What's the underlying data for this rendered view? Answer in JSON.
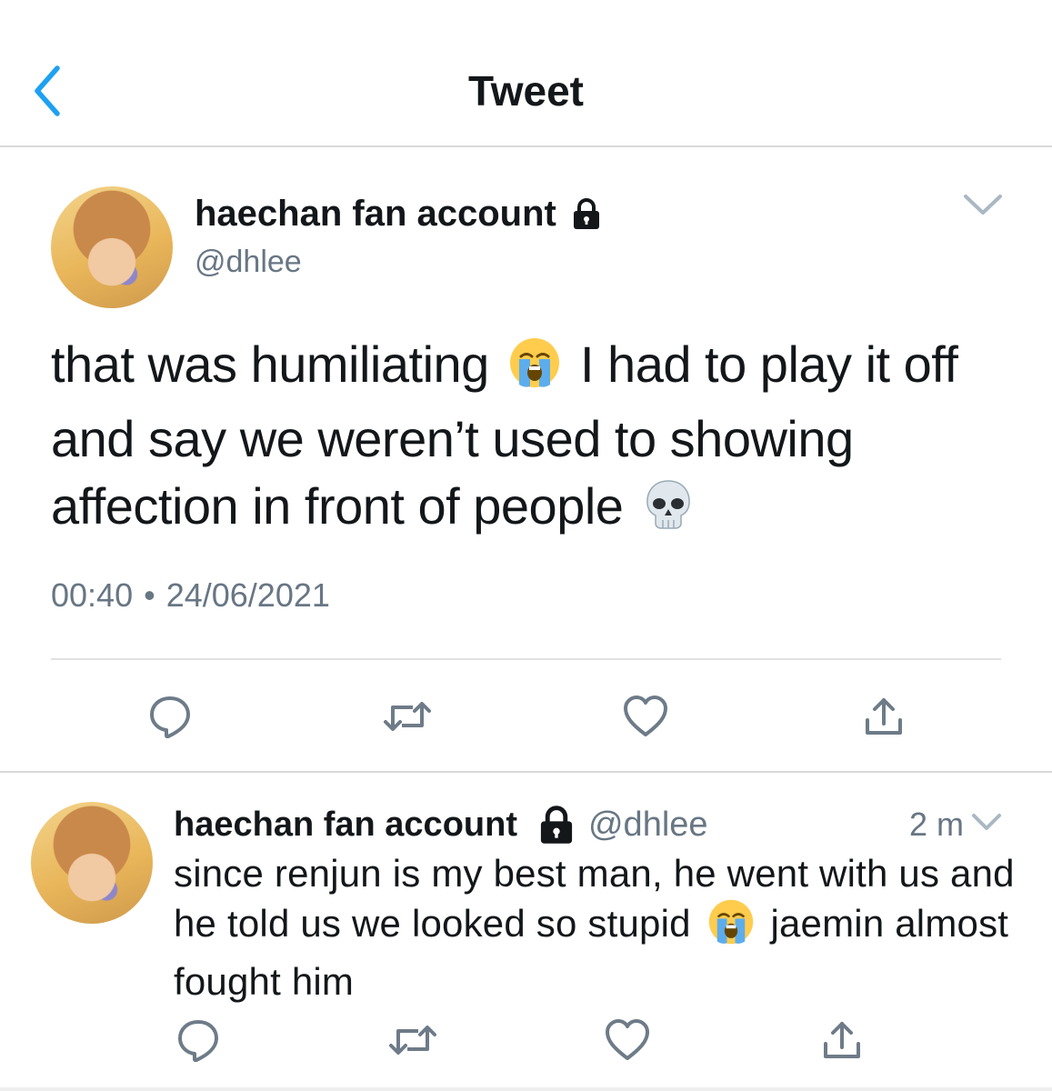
{
  "header": {
    "title": "Tweet",
    "back_icon": "chevron-left-icon",
    "accent": "#1da1f2"
  },
  "tweet": {
    "author_name": "haechan fan account",
    "handle": "@dhlee",
    "protected_icon": "lock-icon",
    "text_before_emoji": "that was humiliating",
    "emoji_1": "loudly-crying-face",
    "text_after_emoji": "I had to play it off and say we weren’t used to showing affection in front of people",
    "emoji_2": "skull",
    "time": "00:40",
    "separator": "•",
    "date": "24/06/2021",
    "actions": [
      "reply-icon",
      "retweet-icon",
      "like-icon",
      "share-icon"
    ]
  },
  "reply": {
    "author_name": "haechan fan account",
    "handle": "@dhlee",
    "age": "2 m",
    "text_before_emoji": "since renjun is my best man, he went with us and he told us we looked so stupid",
    "emoji": "loudly-crying-face",
    "text_after_emoji": "jaemin almost fought him",
    "actions": [
      "reply-icon",
      "retweet-icon",
      "like-icon",
      "share-icon"
    ]
  },
  "colors": {
    "secondary_text": "#687684",
    "icon_gray": "#6e7b88",
    "divider": "#d9d9d9"
  }
}
